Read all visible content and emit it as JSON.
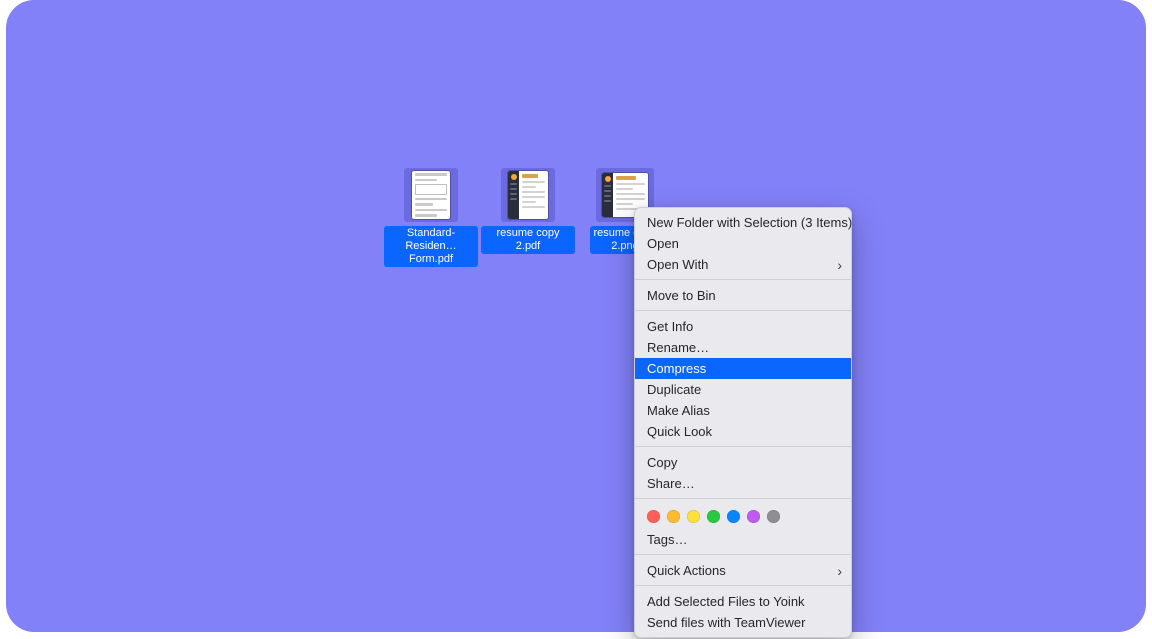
{
  "files": [
    {
      "label": "Standard-\nResiden…Form.pdf"
    },
    {
      "label": "resume copy 2.pdf"
    },
    {
      "label": "resume copy\n2.png"
    }
  ],
  "menu": {
    "new_folder": "New Folder with Selection (3 Items)",
    "open": "Open",
    "open_with": "Open With",
    "move_to_bin": "Move to Bin",
    "get_info": "Get Info",
    "rename": "Rename…",
    "compress": "Compress",
    "duplicate": "Duplicate",
    "make_alias": "Make Alias",
    "quick_look": "Quick Look",
    "copy": "Copy",
    "share": "Share…",
    "tags_label": "Tags…",
    "quick_actions": "Quick Actions",
    "add_to_yoink": "Add Selected Files to Yoink",
    "send_teamviewer": "Send files with TeamViewer"
  },
  "tag_colors": [
    "#ff5f57",
    "#febb2d",
    "#fbe03c",
    "#28c840",
    "#0a84ff",
    "#bf5af2",
    "#8e8e93"
  ]
}
